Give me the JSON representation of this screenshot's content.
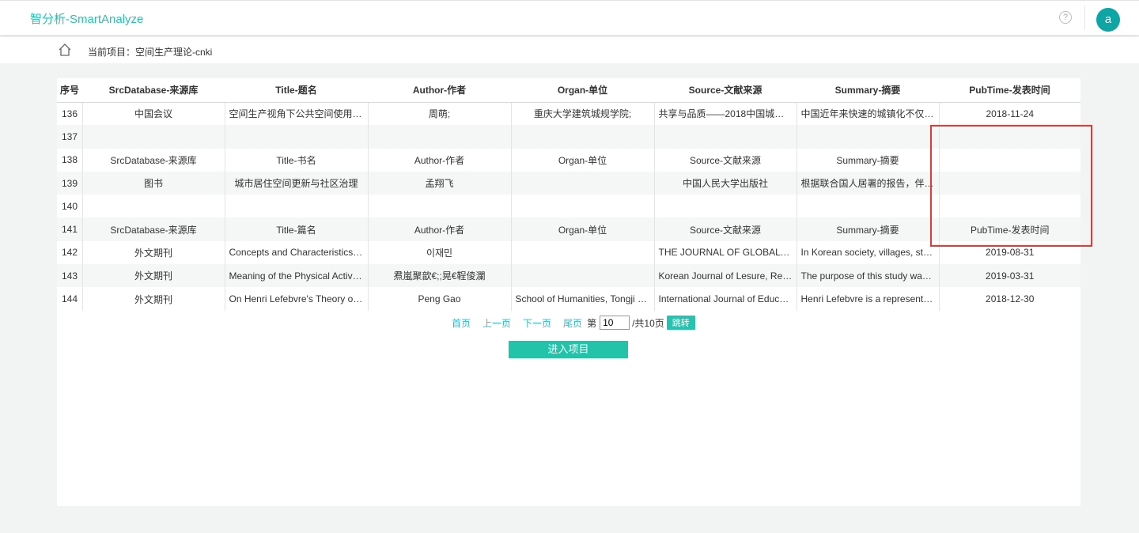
{
  "header": {
    "brand": "智分析-SmartAnalyze",
    "help_icon": "question-circle-icon",
    "avatar_letter": "a"
  },
  "breadcrumb": {
    "home_icon": "home-icon",
    "label": "当前项目：空间生产理论-cnki"
  },
  "table": {
    "columns": [
      "序号",
      "SrcDatabase-来源库",
      "Title-题名",
      "Author-作者",
      "Organ-单位",
      "Source-文献来源",
      "Summary-摘要",
      "PubTime-发表时间"
    ],
    "rows": [
      [
        "136",
        "中国会议",
        "空间生产视角下公共空间使用与…",
        "周萌;",
        "重庆大学建筑城规学院;",
        "共享与品质——2018中国城市…",
        "中国近年来快速的城镇化不仅带…",
        "2018-11-24"
      ],
      [
        "137",
        "",
        "",
        "",
        "",
        "",
        "",
        ""
      ],
      [
        "138",
        "SrcDatabase-来源库",
        "Title-书名",
        "Author-作者",
        "Organ-单位",
        "Source-文献来源",
        "Summary-摘要",
        ""
      ],
      [
        "139",
        "图书",
        "城市居住空间更新与社区治理",
        "孟翔飞",
        "",
        "中国人民大学出版社",
        "根据联合国人居署的报告，伴随…",
        ""
      ],
      [
        "140",
        "",
        "",
        "",
        "",
        "",
        "",
        ""
      ],
      [
        "141",
        "SrcDatabase-来源库",
        "Title-篇名",
        "Author-作者",
        "Organ-单位",
        "Source-文献来源",
        "Summary-摘要",
        "PubTime-发表时间"
      ],
      [
        "142",
        "外文期刊",
        "Concepts and Characteristics o…",
        "이재민",
        "",
        "THE JOURNAL OF GLOBAL C…",
        "In Korean society, villages, stre…",
        "2019-08-31"
      ],
      [
        "143",
        "外文期刊",
        "Meaning of the Physical Activity…",
        "焄嵐聚歆€;;晃€鞓倰瀾",
        "",
        "Korean Journal of Lesure, Recr…",
        "The purpose of this study was t…",
        "2019-03-31"
      ],
      [
        "144",
        "外文期刊",
        "On Henri Lefebvre's Theory of …",
        "Peng Gao",
        "School of Humanities, Tongji Un…",
        "International Journal of Educati…",
        "Henri Lefebvre is a representati…",
        "2018-12-30"
      ]
    ]
  },
  "pager": {
    "first": "首页",
    "prev": "上一页",
    "next": "下一页",
    "last": "尾页",
    "page_prefix": "第",
    "page_value": "10",
    "total": "/共10页",
    "go": "跳转"
  },
  "enter_button": "进入项目",
  "colors": {
    "accent": "#27c2b0",
    "avatar": "#0ea5a5",
    "highlight": "#e53935"
  }
}
